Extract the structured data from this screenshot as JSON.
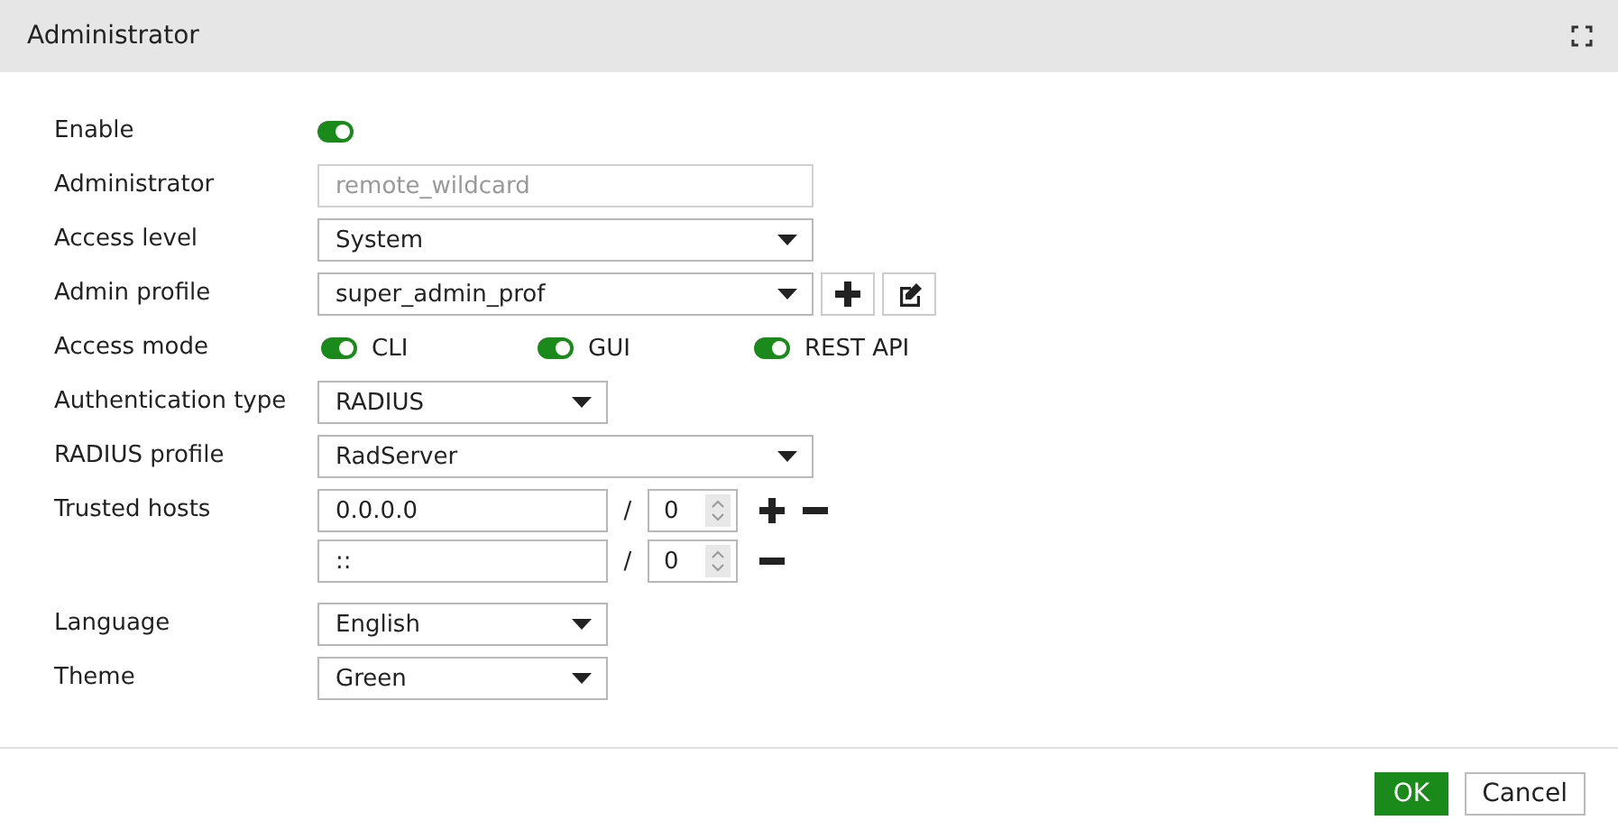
{
  "window": {
    "title": "Administrator"
  },
  "fields": [
    {
      "kind": "toggle",
      "label": "Enable",
      "on": true
    },
    {
      "kind": "text",
      "label": "Administrator",
      "value": "remote_wildcard",
      "disabled": true
    },
    {
      "kind": "select",
      "label": "Access level",
      "value": "System",
      "wide": true
    },
    {
      "kind": "select_buttons",
      "label": "Admin profile",
      "value": "super_admin_prof",
      "wide": true
    },
    {
      "kind": "toggles",
      "label": "Access mode",
      "options": [
        {
          "label": "CLI",
          "on": true
        },
        {
          "label": "GUI",
          "on": true
        },
        {
          "label": "REST API",
          "on": true
        }
      ]
    },
    {
      "kind": "select",
      "label": "Authentication type",
      "value": "RADIUS",
      "wide": false
    },
    {
      "kind": "select",
      "label": "RADIUS profile",
      "value": "RadServer",
      "wide": true
    },
    {
      "kind": "hosts",
      "label": "Trusted hosts",
      "hosts": [
        {
          "address": "0.0.0.0",
          "sep": "/",
          "mask": "0"
        },
        {
          "address": "::",
          "sep": "/",
          "mask": "0"
        }
      ]
    },
    {
      "kind": "select",
      "label": "Language",
      "value": "English",
      "wide": false
    },
    {
      "kind": "select",
      "label": "Theme",
      "value": "Green",
      "wide": false
    }
  ],
  "buttons": [
    {
      "label": "OK",
      "primary": true
    },
    {
      "label": "Cancel",
      "primary": false
    }
  ]
}
